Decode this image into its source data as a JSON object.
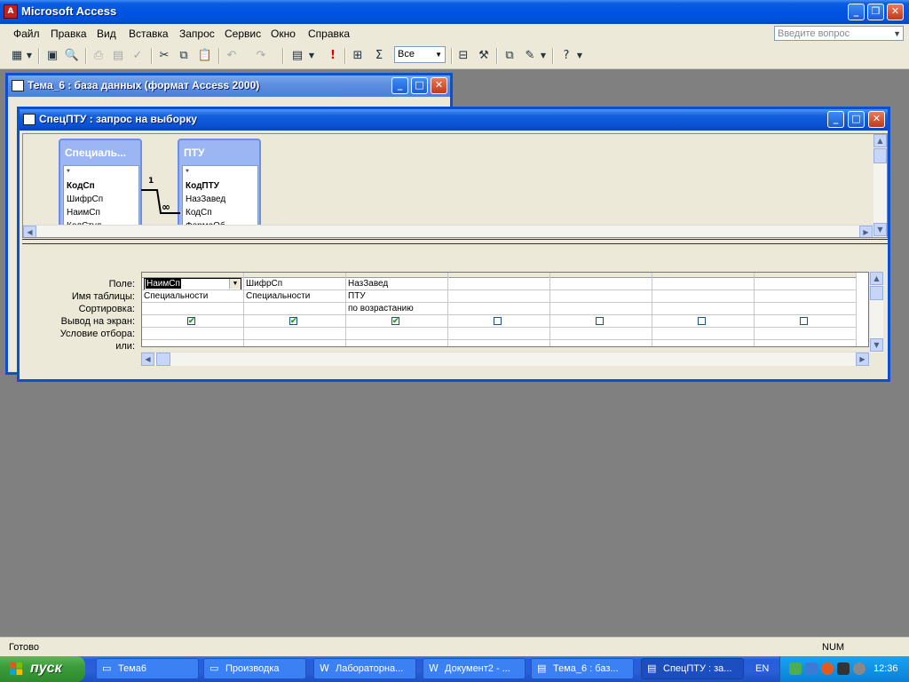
{
  "app": {
    "title": "Microsoft Access",
    "ask_placeholder": "Введите вопрос"
  },
  "menu": [
    "Файл",
    "Правка",
    "Вид",
    "Вставка",
    "Запрос",
    "Сервис",
    "Окно",
    "Справка"
  ],
  "toolbar": {
    "top_values": "Все",
    "sigma": "Σ"
  },
  "db_window": {
    "title": "Тема_6 : база данных (формат Access 2000)"
  },
  "query_window": {
    "title": "СпецПТУ : запрос на выборку",
    "tables": [
      {
        "title": "Специаль...",
        "fields": [
          "*",
          "КодСп",
          "ШифрСп",
          "НаимСп",
          "КолСтуд"
        ],
        "key_index": 1
      },
      {
        "title": "ПТУ",
        "fields": [
          "*",
          "КодПТУ",
          "НазЗавед",
          "КодСп",
          "ФормаОб"
        ],
        "key_index": 1
      }
    ],
    "relation": {
      "one": "1",
      "many": "∞"
    },
    "grid_labels": [
      "Поле:",
      "Имя таблицы:",
      "Сортировка:",
      "Вывод на экран:",
      "Условие отбора:",
      "или:"
    ],
    "columns": [
      {
        "field": "НаимСп",
        "table": "Специальности",
        "sort": "",
        "show": true
      },
      {
        "field": "ШифрСп",
        "table": "Специальности",
        "sort": "",
        "show": true
      },
      {
        "field": "НазЗавед",
        "table": "ПТУ",
        "sort": "по возрастанию",
        "show": true
      },
      {
        "field": "",
        "table": "",
        "sort": "",
        "show": false
      },
      {
        "field": "",
        "table": "",
        "sort": "",
        "show": false
      },
      {
        "field": "",
        "table": "",
        "sort": "",
        "show": false
      },
      {
        "field": "",
        "table": "",
        "sort": "",
        "show": false
      }
    ]
  },
  "status": {
    "text": "Готово",
    "num": "NUM"
  },
  "taskbar": {
    "start": "пуск",
    "tasks": [
      {
        "label": "Тема6",
        "icon": "folder-icon"
      },
      {
        "label": "Производка",
        "icon": "folder-icon"
      },
      {
        "label": "Лабораторна...",
        "icon": "word-icon"
      },
      {
        "label": "Документ2 - ...",
        "icon": "word-icon"
      },
      {
        "label": "Тема_6 : баз...",
        "icon": "database-icon"
      },
      {
        "label": "СпецПТУ : за...",
        "icon": "query-icon"
      }
    ],
    "active_index": 5,
    "lang": "EN",
    "clock": "12:36"
  }
}
